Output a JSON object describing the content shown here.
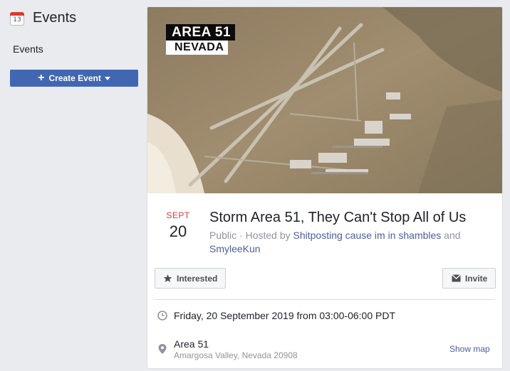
{
  "sidebar": {
    "title": "Events",
    "calendar_day": "13",
    "nav_item": "Events",
    "create_button": "Create Event"
  },
  "cover": {
    "banner_line1": "AREA 51",
    "banner_line2": "NEVADA"
  },
  "event": {
    "month": "SEPT",
    "day": "20",
    "title": "Storm Area 51, They Can't Stop All of Us",
    "privacy": "Public",
    "hosted_by_prefix": " · Hosted by ",
    "host1": "Shitposting cause im in shambles",
    "and_word": " and ",
    "host2": "SmyleeKun",
    "interested_label": "Interested",
    "invite_label": "Invite",
    "datetime": "Friday, 20 September 2019 from 03:00-06:00 PDT",
    "location_name": "Area 51",
    "location_address": "Amargosa Valley, Nevada 20908",
    "show_map_label": "Show map"
  },
  "colors": {
    "accent": "#4267b2",
    "month_red": "#e0393e",
    "link": "#4b5ea1"
  },
  "icons": [
    "calendar-icon",
    "plus-icon",
    "caret-down-icon",
    "star-icon",
    "envelope-icon",
    "clock-icon",
    "map-pin-icon"
  ]
}
